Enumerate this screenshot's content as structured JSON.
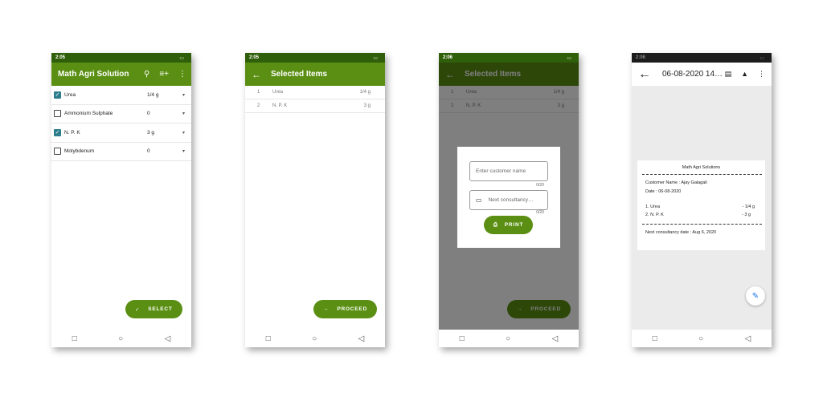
{
  "status_times": [
    "2:05",
    "2:05",
    "2:06",
    "2:06"
  ],
  "screen1": {
    "title": "Math Agri Solution",
    "items": [
      {
        "name": "Urea",
        "checked": true,
        "qty": "1/4 g"
      },
      {
        "name": "Ammonium Sulphate",
        "checked": false,
        "qty": "0"
      },
      {
        "name": "N. P. K",
        "checked": true,
        "qty": "3 g"
      },
      {
        "name": "Molybdenum",
        "checked": false,
        "qty": "0"
      }
    ],
    "fab_label": "SELECT"
  },
  "screen2": {
    "title": "Selected Items",
    "rows": [
      {
        "no": "1",
        "name": "Urea",
        "qty": "1/4 g"
      },
      {
        "no": "2",
        "name": "N. P. K",
        "qty": "3 g"
      }
    ],
    "fab_label": "PROCEED"
  },
  "screen3": {
    "title": "Selected Items",
    "rows": [
      {
        "no": "1",
        "name": "Urea",
        "qty": "1/4 g"
      },
      {
        "no": "2",
        "name": "N. P. K",
        "qty": "3 g"
      }
    ],
    "customer_placeholder": "Enter customer name",
    "customer_counter": "0/20",
    "date_placeholder": "Next consultancy…",
    "date_counter": "0/20",
    "print_label": "PRINT",
    "fab_label": "PROCEED"
  },
  "screen4": {
    "title": "06-08-2020 14…",
    "receipt": {
      "heading": "Math Agri Solutions",
      "customer": "Customer Name : Ajay Galagali",
      "date": "Date : 06-08-2020",
      "lines": [
        {
          "name": "1. Urea",
          "qty": "- 1/4 g"
        },
        {
          "name": "2. N. P. K",
          "qty": "- 3 g"
        }
      ],
      "next_date": "Next consultancy date : Aug 6, 2020"
    }
  },
  "colors": {
    "primary": "#5a8f13",
    "status": "#2f5f0a",
    "checkbox": "#2e7d8c"
  }
}
